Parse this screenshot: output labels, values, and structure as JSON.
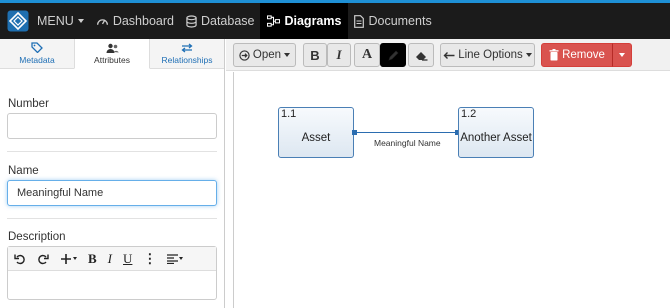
{
  "colors": {
    "accent": "#1e90d6",
    "navbar": "#1b1b1b",
    "remove_button": "#d9534f",
    "node_border": "#4a7fb5",
    "link_text": "#1f6fb5"
  },
  "nav": {
    "menu_label": "MENU",
    "items": [
      {
        "label": "Dashboard",
        "icon": "gauge-icon"
      },
      {
        "label": "Database",
        "icon": "database-icon"
      },
      {
        "label": "Diagrams",
        "icon": "sitemap-icon",
        "active": true
      },
      {
        "label": "Documents",
        "icon": "document-icon"
      }
    ]
  },
  "left_tabs": [
    {
      "label": "Metadata",
      "icon": "tag-icon"
    },
    {
      "label": "Attributes",
      "icon": "users-icon",
      "active": true
    },
    {
      "label": "Relationships",
      "icon": "exchange-icon"
    }
  ],
  "form": {
    "number_label": "Number",
    "number_value": "",
    "name_label": "Name",
    "name_value": "Meaningful Name",
    "description_label": "Description"
  },
  "toolbar": {
    "open_label": "Open",
    "bold_label": "B",
    "italic_label": "I",
    "font_color_label": "A",
    "line_options_label": "Line Options",
    "remove_label": "Remove"
  },
  "editor_toolbar": {
    "bold": "B",
    "italic": "I",
    "underline": "U",
    "more": "⋮"
  },
  "diagram": {
    "nodes": [
      {
        "number": "1.1",
        "label": "Asset"
      },
      {
        "number": "1.2",
        "label": "Another Asset"
      }
    ],
    "edge_label": "Meaningful Name"
  }
}
